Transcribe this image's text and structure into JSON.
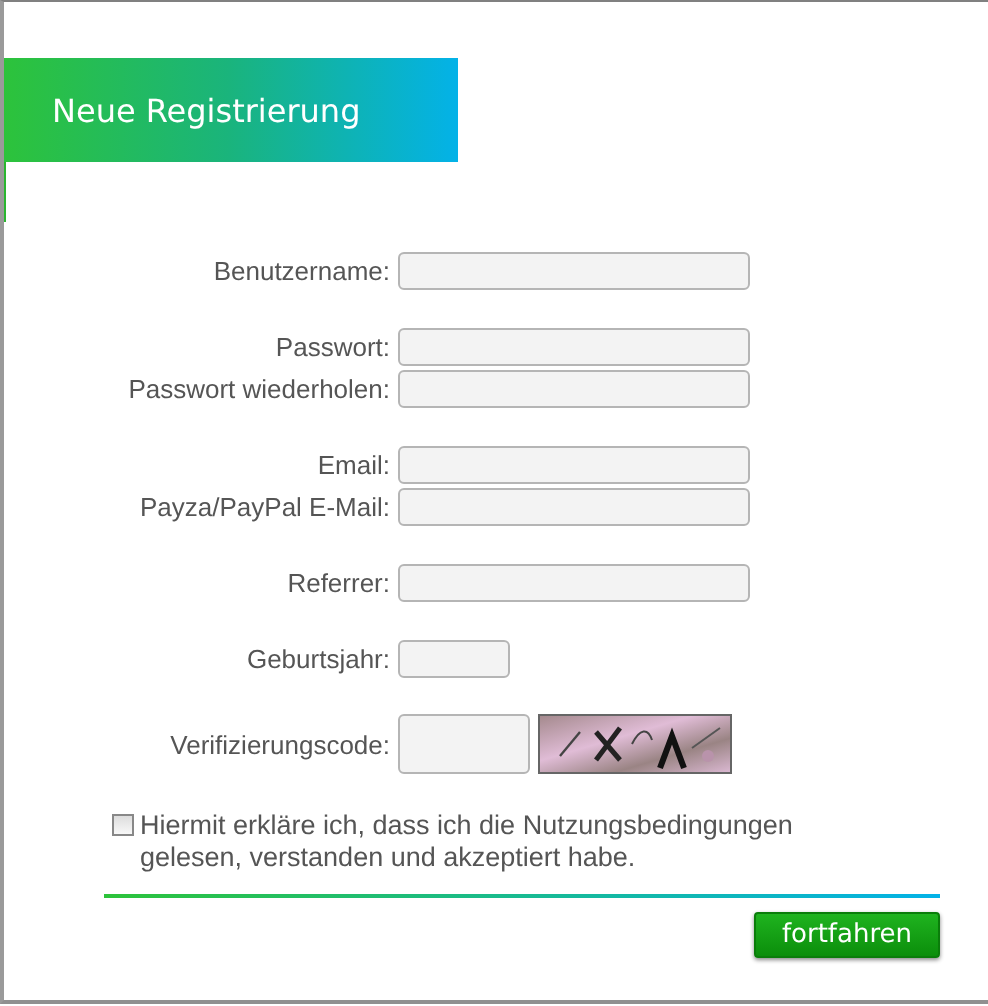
{
  "header": {
    "title": "Neue Registrierung"
  },
  "groups": [
    [
      {
        "label": "Benutzername:",
        "kind": "text"
      }
    ],
    [
      {
        "label": "Passwort:",
        "kind": "text"
      },
      {
        "label": "Passwort wiederholen:",
        "kind": "text"
      }
    ],
    [
      {
        "label": "Email:",
        "kind": "text"
      },
      {
        "label": "Payza/PayPal E-Mail:",
        "kind": "text"
      }
    ],
    [
      {
        "label": "Referrer:",
        "kind": "text"
      }
    ],
    [
      {
        "label": "Geburtsjahr:",
        "kind": "year"
      }
    ],
    [
      {
        "label": "Verifizierungscode:",
        "kind": "captcha"
      }
    ]
  ],
  "terms": {
    "checked": false,
    "text": "Hiermit erkläre ich, dass ich die Nutzungsbedingungen gelesen, verstanden und akzeptiert habe."
  },
  "submit": "fortfahren"
}
